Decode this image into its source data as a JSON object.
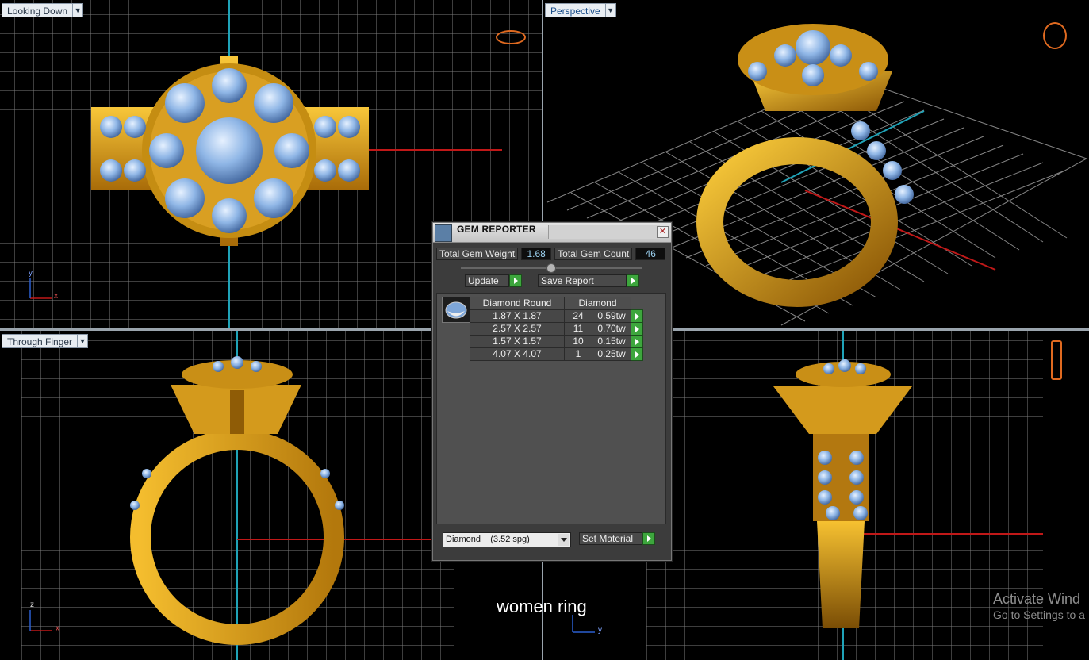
{
  "viewports": {
    "top": {
      "label": "Looking Down"
    },
    "perspective": {
      "label": "Perspective"
    },
    "front": {
      "label": "Through Finger"
    },
    "side": {
      "label": ""
    }
  },
  "axes": {
    "top": [
      "y",
      "x"
    ],
    "front": [
      "z",
      "x"
    ],
    "side": [
      "y"
    ]
  },
  "gem_reporter": {
    "title": "GEM REPORTER",
    "total_weight_label": "Total Gem Weight",
    "total_weight": "1.68",
    "total_count_label": "Total Gem Count",
    "total_count": "46",
    "update_label": "Update",
    "save_label": "Save Report",
    "table": {
      "headers": [
        "Diamond Round",
        "Diamond"
      ],
      "rows": [
        {
          "size": "1.87 X 1.87",
          "count": "24",
          "weight": "0.59tw"
        },
        {
          "size": "2.57 X 2.57",
          "count": "11",
          "weight": "0.70tw"
        },
        {
          "size": "1.57 X 1.57",
          "count": "10",
          "weight": "0.15tw"
        },
        {
          "size": "4.07 X 4.07",
          "count": "1",
          "weight": "0.25tw"
        }
      ]
    },
    "material_select": "Diamond    (3.52 spg)",
    "set_material_label": "Set Material"
  },
  "caption": "women ring",
  "watermark": {
    "title": "Activate Wind",
    "subtitle": "Go to Settings to a"
  },
  "colors": {
    "gold": "#e0a420",
    "gem": "#8fb6e6",
    "grid": "#8c8c8c",
    "cyan_axis": "#1fa3b8",
    "red_axis": "#c01818"
  }
}
